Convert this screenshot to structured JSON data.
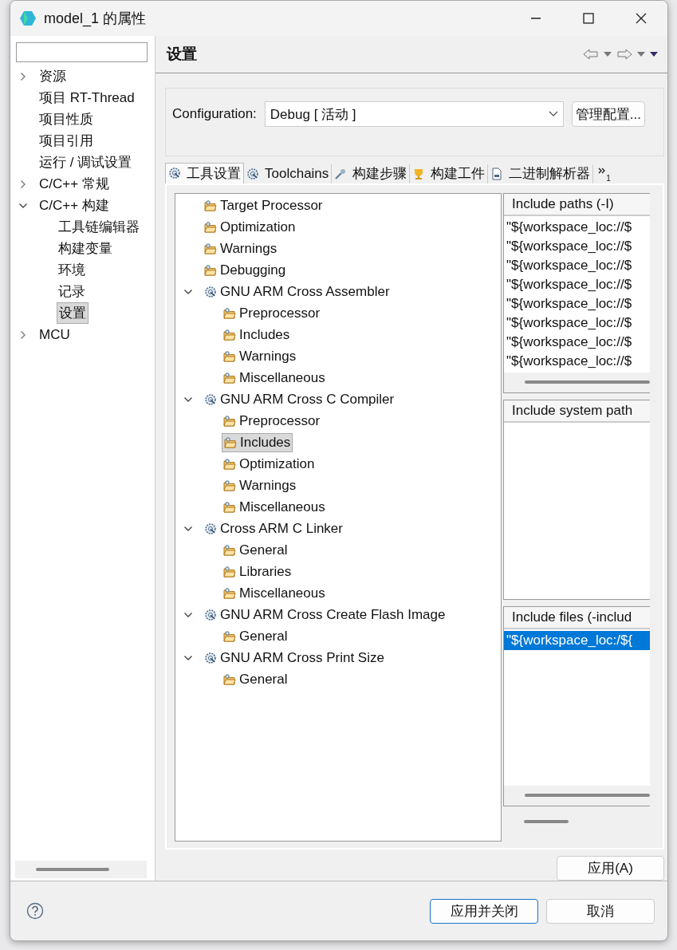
{
  "window": {
    "title": "model_1 的属性"
  },
  "sidebar": {
    "items": [
      {
        "label": "资源",
        "expanded": false,
        "selected": false
      },
      {
        "label": "项目 RT-Thread",
        "selected": false
      },
      {
        "label": "项目性质",
        "selected": false
      },
      {
        "label": "项目引用",
        "selected": false
      },
      {
        "label": "运行 / 调试设置",
        "selected": false
      },
      {
        "label": "C/C++ 常规",
        "expanded": false,
        "selected": false
      },
      {
        "label": "C/C++ 构建",
        "expanded": true,
        "selected": false,
        "children": [
          {
            "label": "工具链编辑器",
            "selected": false
          },
          {
            "label": "构建变量",
            "selected": false
          },
          {
            "label": "环境",
            "selected": false
          },
          {
            "label": "记录",
            "selected": false
          },
          {
            "label": "设置",
            "selected": true
          }
        ]
      },
      {
        "label": "MCU",
        "expanded": false,
        "selected": false
      }
    ]
  },
  "page": {
    "title": "设置"
  },
  "configuration": {
    "label": "Configuration:",
    "value": "Debug  [ 活动 ]",
    "manage_button": "管理配置..."
  },
  "tabs": [
    {
      "label": "工具设置",
      "selected": true
    },
    {
      "label": "Toolchains",
      "selected": false
    },
    {
      "label": "构建步骤",
      "selected": false
    },
    {
      "label": "构建工件",
      "selected": false
    },
    {
      "label": "二进制解析器",
      "selected": false
    }
  ],
  "tabs_overflow": {
    "count": "1"
  },
  "tool_tree": [
    {
      "label": "Target Processor",
      "kind": "option",
      "selected": false
    },
    {
      "label": "Optimization",
      "kind": "option",
      "selected": false
    },
    {
      "label": "Warnings",
      "kind": "option",
      "selected": false
    },
    {
      "label": "Debugging",
      "kind": "option",
      "selected": false
    },
    {
      "label": "GNU ARM Cross Assembler",
      "kind": "tool",
      "expanded": true,
      "selected": false,
      "children": [
        {
          "label": "Preprocessor",
          "kind": "option",
          "selected": false
        },
        {
          "label": "Includes",
          "kind": "option",
          "selected": false
        },
        {
          "label": "Warnings",
          "kind": "option",
          "selected": false
        },
        {
          "label": "Miscellaneous",
          "kind": "option",
          "selected": false
        }
      ]
    },
    {
      "label": "GNU ARM Cross C Compiler",
      "kind": "tool",
      "expanded": true,
      "selected": false,
      "children": [
        {
          "label": "Preprocessor",
          "kind": "option",
          "selected": false
        },
        {
          "label": "Includes",
          "kind": "option",
          "selected": true
        },
        {
          "label": "Optimization",
          "kind": "option",
          "selected": false
        },
        {
          "label": "Warnings",
          "kind": "option",
          "selected": false
        },
        {
          "label": "Miscellaneous",
          "kind": "option",
          "selected": false
        }
      ]
    },
    {
      "label": "Cross ARM C Linker",
      "kind": "tool",
      "expanded": true,
      "selected": false,
      "children": [
        {
          "label": "General",
          "kind": "option",
          "selected": false
        },
        {
          "label": "Libraries",
          "kind": "option",
          "selected": false
        },
        {
          "label": "Miscellaneous",
          "kind": "option",
          "selected": false
        }
      ]
    },
    {
      "label": "GNU ARM Cross Create Flash Image",
      "kind": "tool",
      "expanded": true,
      "selected": false,
      "children": [
        {
          "label": "General",
          "kind": "option",
          "selected": false
        }
      ]
    },
    {
      "label": "GNU ARM Cross Print Size",
      "kind": "tool",
      "expanded": true,
      "selected": false,
      "children": [
        {
          "label": "General",
          "kind": "option",
          "selected": false
        }
      ]
    }
  ],
  "lists": [
    {
      "title": "Include paths (-I)",
      "rows": [
        {
          "text": "\"${workspace_loc://$",
          "selected": false
        },
        {
          "text": "\"${workspace_loc://$",
          "selected": false
        },
        {
          "text": "\"${workspace_loc://$",
          "selected": false
        },
        {
          "text": "\"${workspace_loc://$",
          "selected": false
        },
        {
          "text": "\"${workspace_loc://$",
          "selected": false
        },
        {
          "text": "\"${workspace_loc://$",
          "selected": false
        },
        {
          "text": "\"${workspace_loc://$",
          "selected": false
        },
        {
          "text": "\"${workspace_loc://$",
          "selected": false
        }
      ]
    },
    {
      "title": "Include system path"
    },
    {
      "title": "Include files (-includ",
      "rows": [
        {
          "text": "\"${workspace_loc:/${",
          "selected": true
        }
      ]
    }
  ],
  "apply_button": "应用(A)",
  "footer_buttons": [
    {
      "label": "应用并关闭",
      "default": true
    },
    {
      "label": "取消",
      "default": false
    }
  ]
}
